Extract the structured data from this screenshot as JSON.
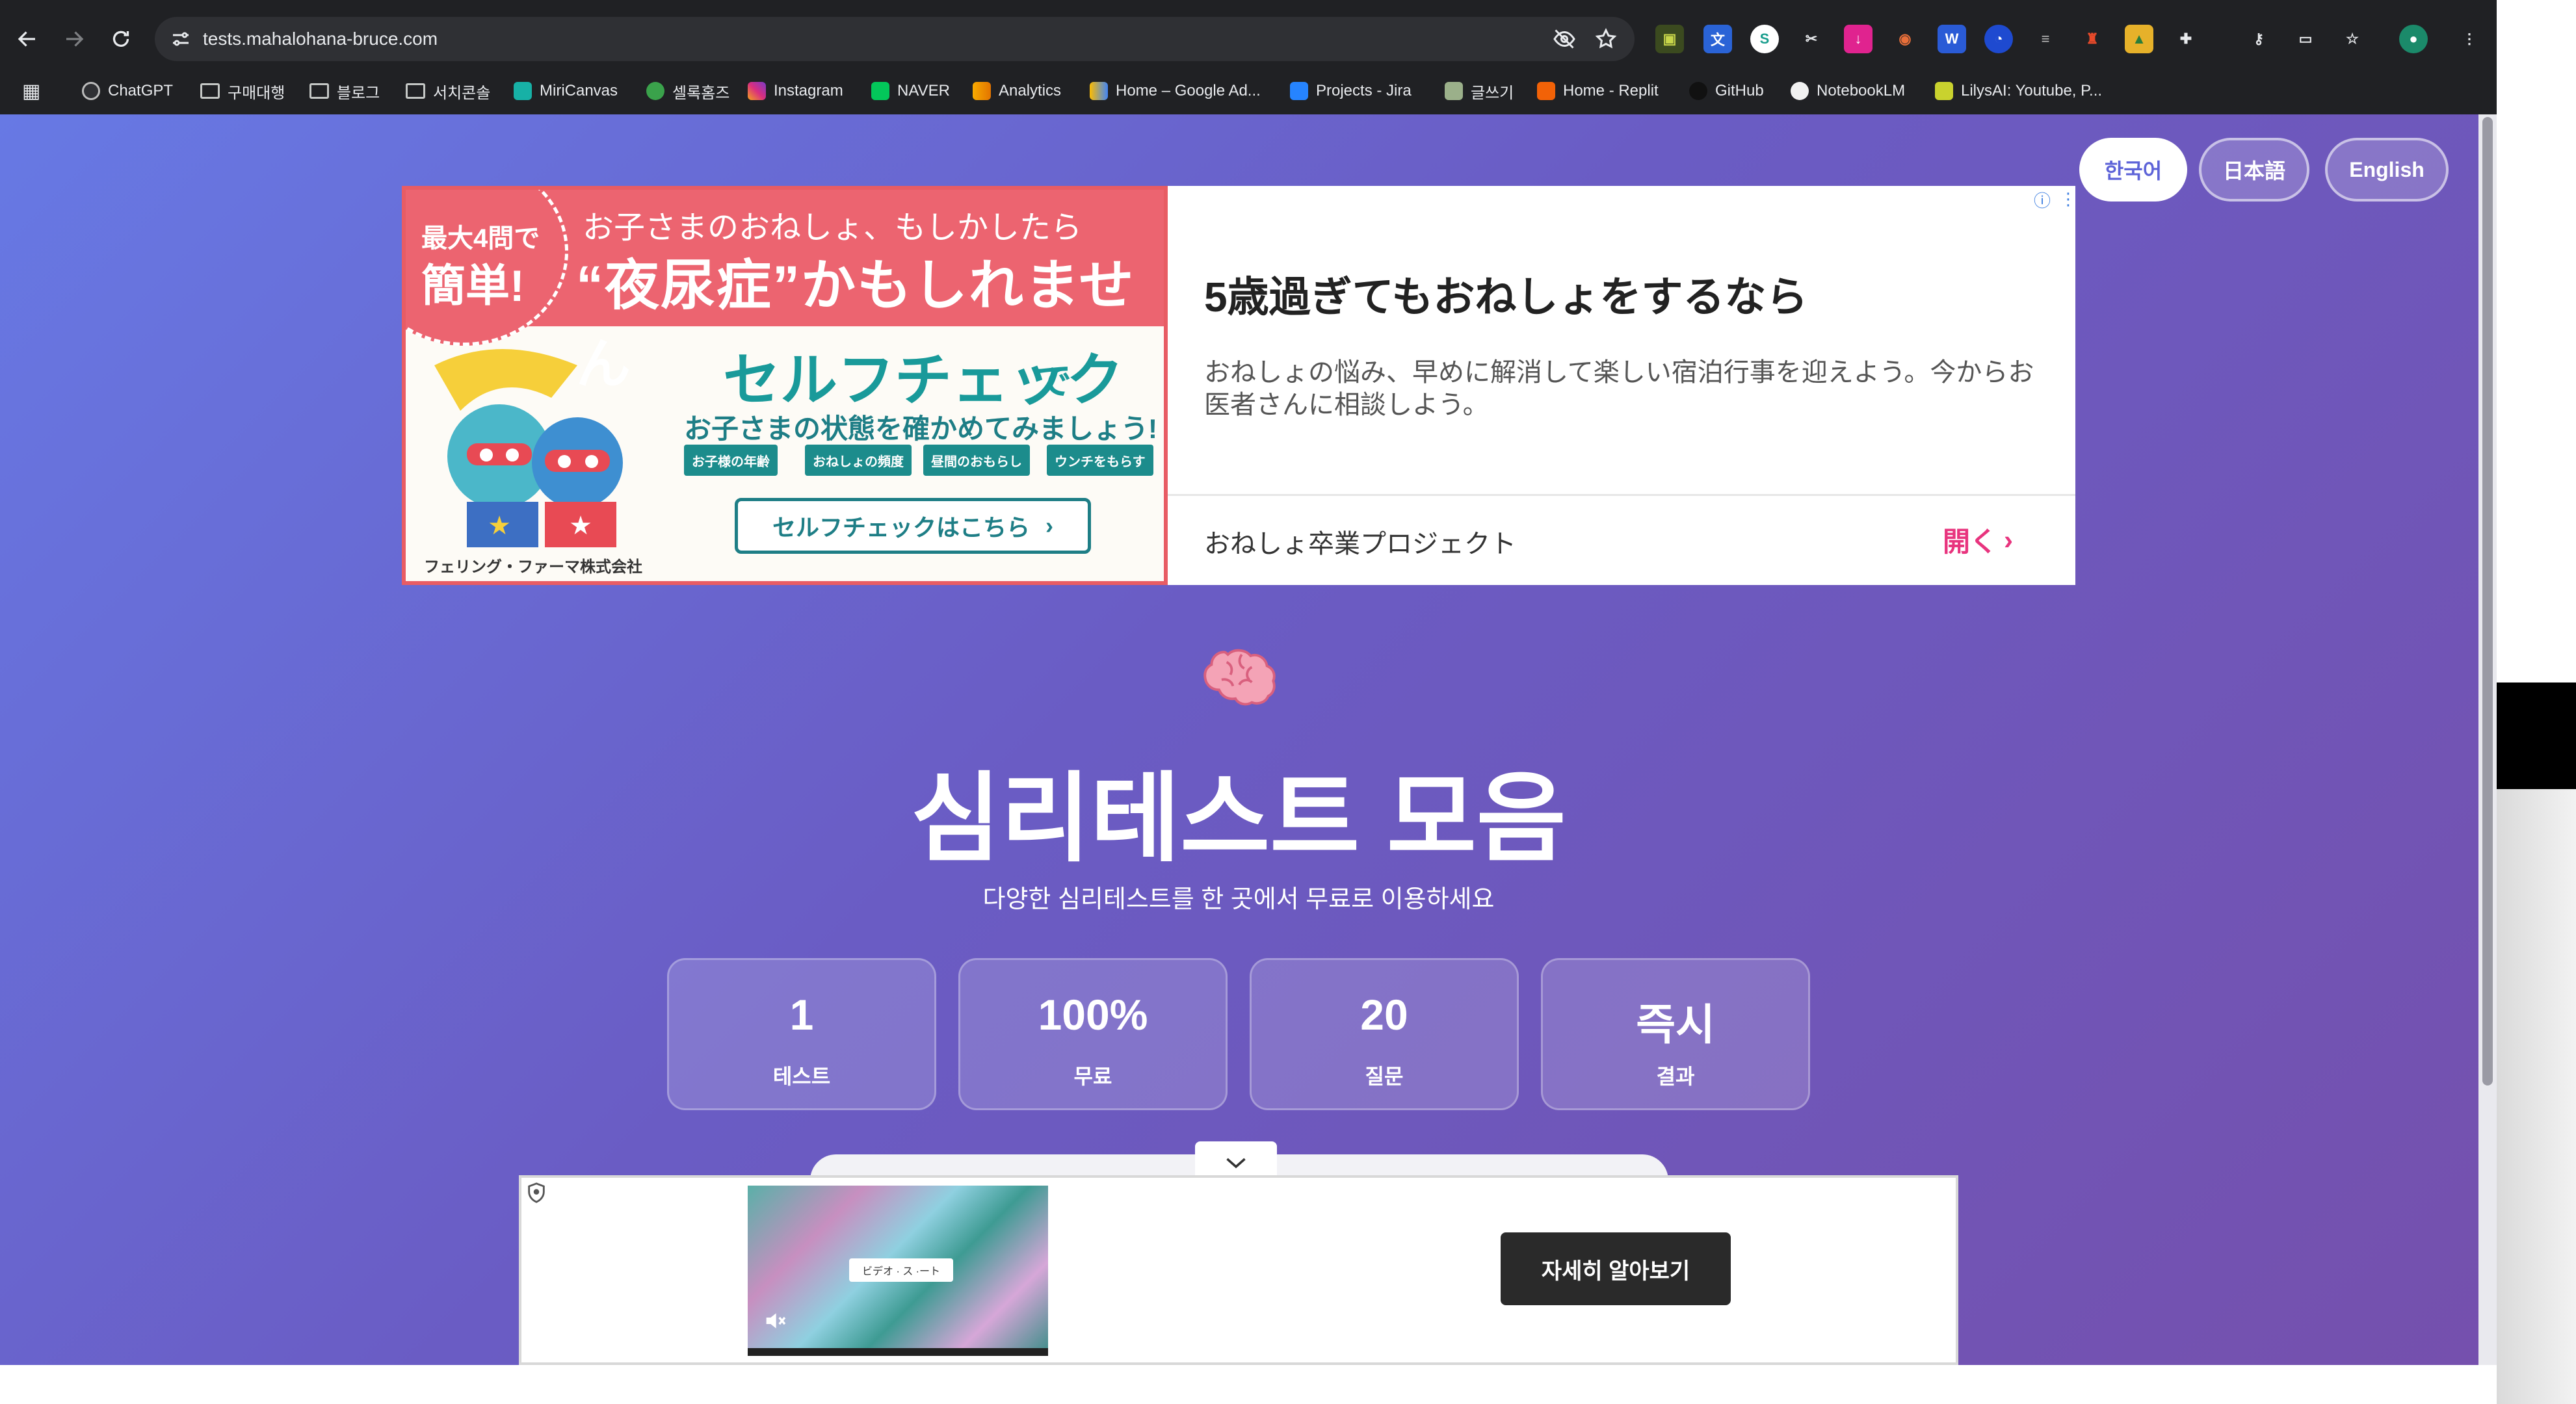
{
  "browser": {
    "url": "tests.mahalohana-bruce.com",
    "bookmarks": [
      "ChatGPT",
      "구매대행",
      "블로그",
      "서치콘솔",
      "MiriCanvas",
      "셀록홈즈",
      "Instagram",
      "NAVER",
      "Analytics",
      "Home – Google Ad...",
      "Projects - Jira",
      "글쓰기",
      "Home - Replit",
      "GitHub",
      "NotebookLM",
      "LilysAI: Youtube, P..."
    ]
  },
  "lang": {
    "ko": "한국어",
    "ja": "日本語",
    "en": "English",
    "active": "ko"
  },
  "ad_top": {
    "badge_small": "最大4問で",
    "badge_big": "簡単!",
    "line1": "お子さまのおねしょ、もしかしたら",
    "line2": "“夜尿症”かもしれません",
    "self_check": "セルフチェック",
    "self_check_suffix": "で",
    "check_line": "お子さまの状態を確かめてみましょう!",
    "chips": [
      "お子様の年齢",
      "おねしょの頻度",
      "昼間のおもらし",
      "ウンチをもらす"
    ],
    "cta": "セルフチェックはこちら",
    "company": "フェリング・ファーマ株式会社",
    "title": "5歳過ぎてもおねしょをするなら",
    "description": "おねしょの悩み、早めに解消して楽しい宿泊行事を迎えよう。今からお医者さんに相談しよう。",
    "advertiser": "おねしょ卒業プロジェクト",
    "open": "開く"
  },
  "hero": {
    "title": "심리테스트 모음",
    "subtitle": "다양한 심리테스트를 한 곳에서 무료로 이용하세요"
  },
  "stats": [
    {
      "value": "1",
      "label": "테스트"
    },
    {
      "value": "100%",
      "label": "무료"
    },
    {
      "value": "20",
      "label": "질문"
    },
    {
      "value": "즉시",
      "label": "결과"
    }
  ],
  "ad_bottom": {
    "caption": "ビデオ · ス ·ート",
    "cta": "자세히 알아보기"
  },
  "colors": {
    "accent": "#5d63d8",
    "ad_pink": "#ec6470",
    "ad_teal": "#199a9a",
    "open_pink": "#e8347e"
  }
}
